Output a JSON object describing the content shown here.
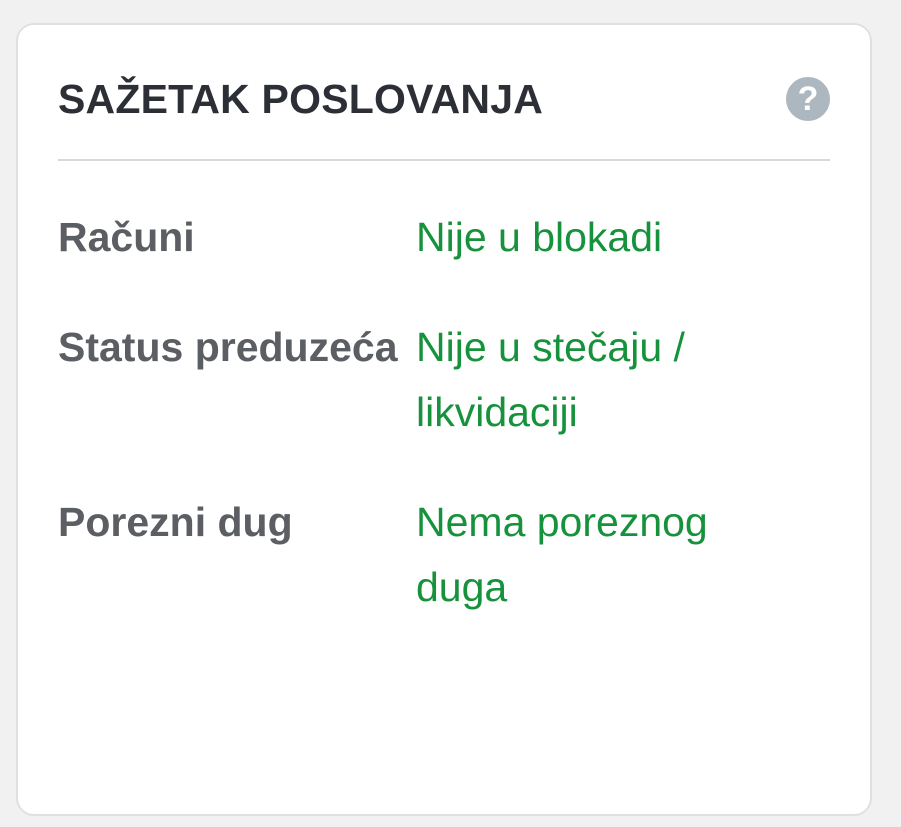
{
  "card": {
    "title": "SAŽETAK POSLOVANJA",
    "help_icon": "question-circle-icon",
    "help_symbol": "?",
    "rows": [
      {
        "label": "Računi",
        "value": "Nije u blokadi"
      },
      {
        "label": "Status preduzeća",
        "value": "Nije u stečaju / likvidaciji"
      },
      {
        "label": "Porezni dug",
        "value": "Nema poreznog duga"
      }
    ]
  },
  "colors": {
    "title": "#2c3036",
    "label": "#5b5e62",
    "status_ok": "#17923c",
    "help_icon": "#adb7bf",
    "divider": "#d6dadd",
    "background": "#f1f1f1"
  }
}
